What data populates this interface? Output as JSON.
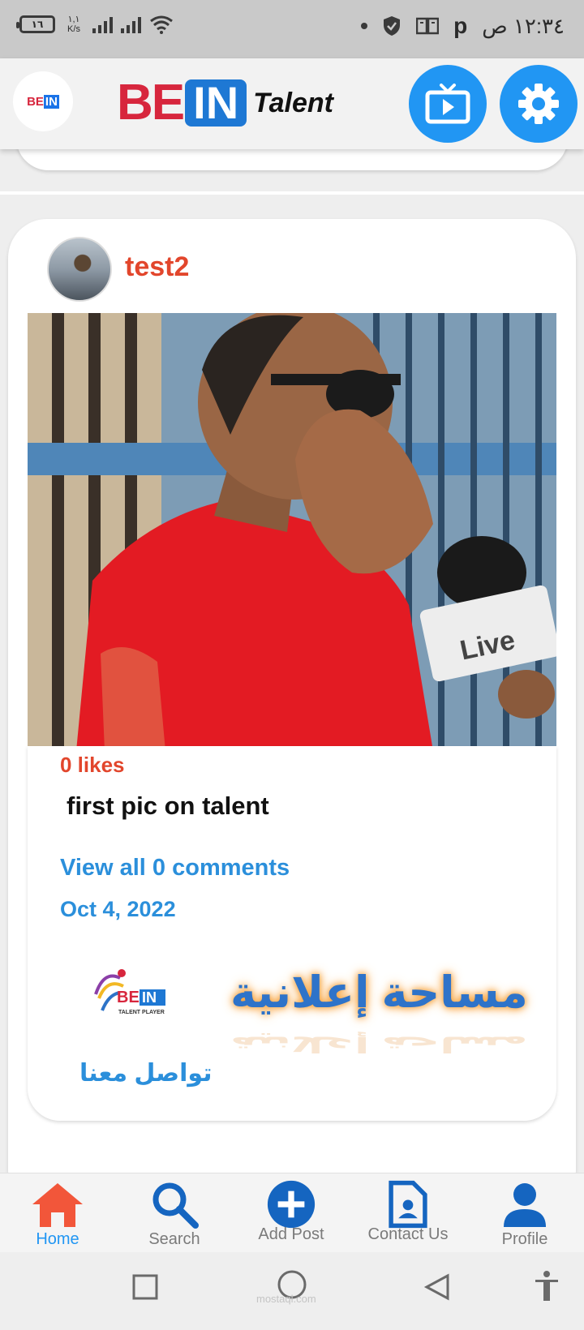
{
  "status_bar": {
    "battery_level": "١٦",
    "net_speed_value": "١,١",
    "net_speed_unit": "K/s",
    "clock": "١٢:٣٤ ص",
    "carrier_letter": "p"
  },
  "header": {
    "logo_be": "BE",
    "logo_in": "IN",
    "logo_talent": "Talent",
    "mini_logo_be": "BE",
    "mini_logo_in": "IN",
    "tv_icon": "tv-icon",
    "settings_icon": "gear-icon"
  },
  "post": {
    "username": "test2",
    "likes": "0 likes",
    "caption": "first pic on talent",
    "view_comments": "View all 0 comments",
    "date": "Oct 4, 2022",
    "image_overlay": "Live"
  },
  "ad": {
    "brand_be": "BE",
    "brand_in": "IN",
    "brand_sub": "TALENT PLAYER",
    "ad_text": "مساحة إعلانية",
    "contact_text": "تواصل معنا"
  },
  "bottom_nav": {
    "items": [
      {
        "label": "Home",
        "icon": "home-icon",
        "active": true
      },
      {
        "label": "Search",
        "icon": "search-icon",
        "active": false
      },
      {
        "label": "Add Post",
        "icon": "add-icon",
        "active": false
      },
      {
        "label": "Contact Us",
        "icon": "contact-icon",
        "active": false
      },
      {
        "label": "Profile",
        "icon": "profile-icon",
        "active": false
      }
    ]
  },
  "watermark": "mostaql.com",
  "colors": {
    "accent_blue": "#2196f3",
    "username_red": "#e2462c",
    "link_blue": "#2b8fdb",
    "brand_red": "#d7263d"
  }
}
